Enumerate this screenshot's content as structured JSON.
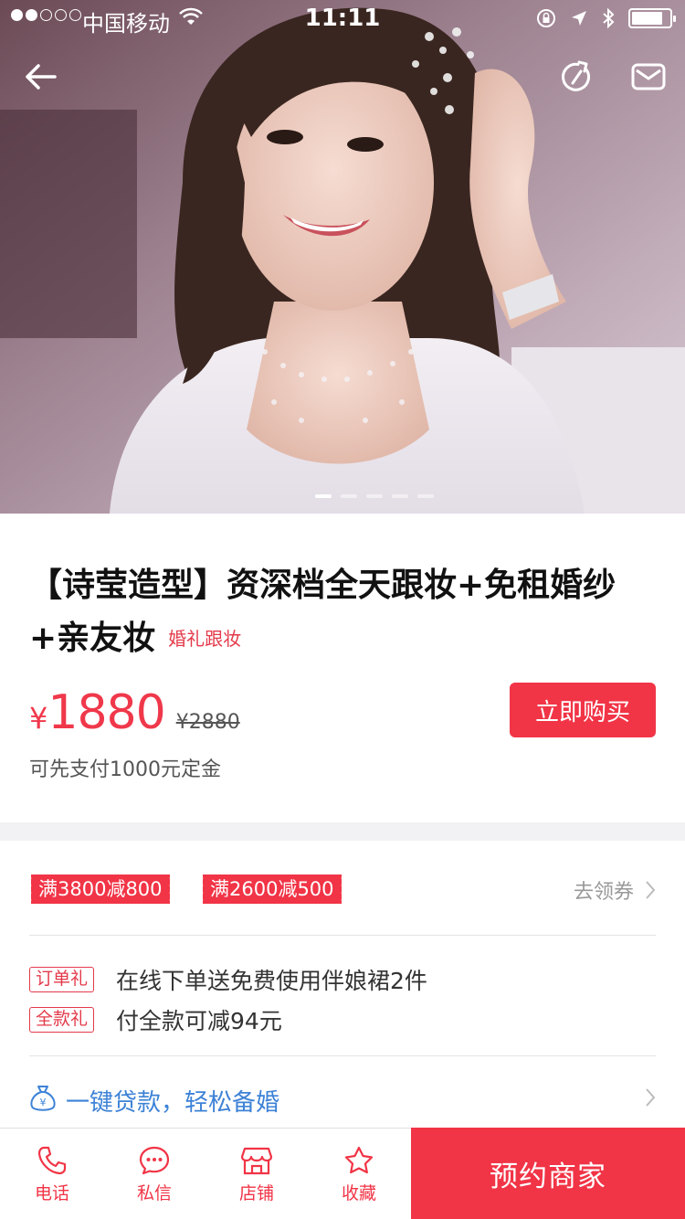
{
  "status_bar": {
    "carrier": "中国移动",
    "time": "11:11",
    "battery_level": 0.82
  },
  "hero": {
    "page_count": 5,
    "active_page": 1
  },
  "product": {
    "title": "【诗莹造型】资深档全天跟妆+免租婚纱+亲友妆",
    "category": "婚礼跟妆",
    "currency": "¥",
    "price": "1880",
    "original_price": "¥2880",
    "deposit_note": "可先支付1000元定金",
    "buy_label": "立即购买"
  },
  "coupons": {
    "items": [
      "满3800减800",
      "满2600减500"
    ],
    "get_label": "去领券"
  },
  "gifts": [
    {
      "tag": "订单礼",
      "text": "在线下单送免费使用伴娘裙2件"
    },
    {
      "tag": "全款礼",
      "text": "付全款可减94元"
    }
  ],
  "loan": {
    "text": "一键贷款，轻松备婚"
  },
  "tabbar": {
    "phone": "电话",
    "message": "私信",
    "shop": "店铺",
    "favorite": "收藏",
    "reserve": "预约商家"
  },
  "colors": {
    "accent": "#f13446",
    "link": "#3d82d6"
  }
}
